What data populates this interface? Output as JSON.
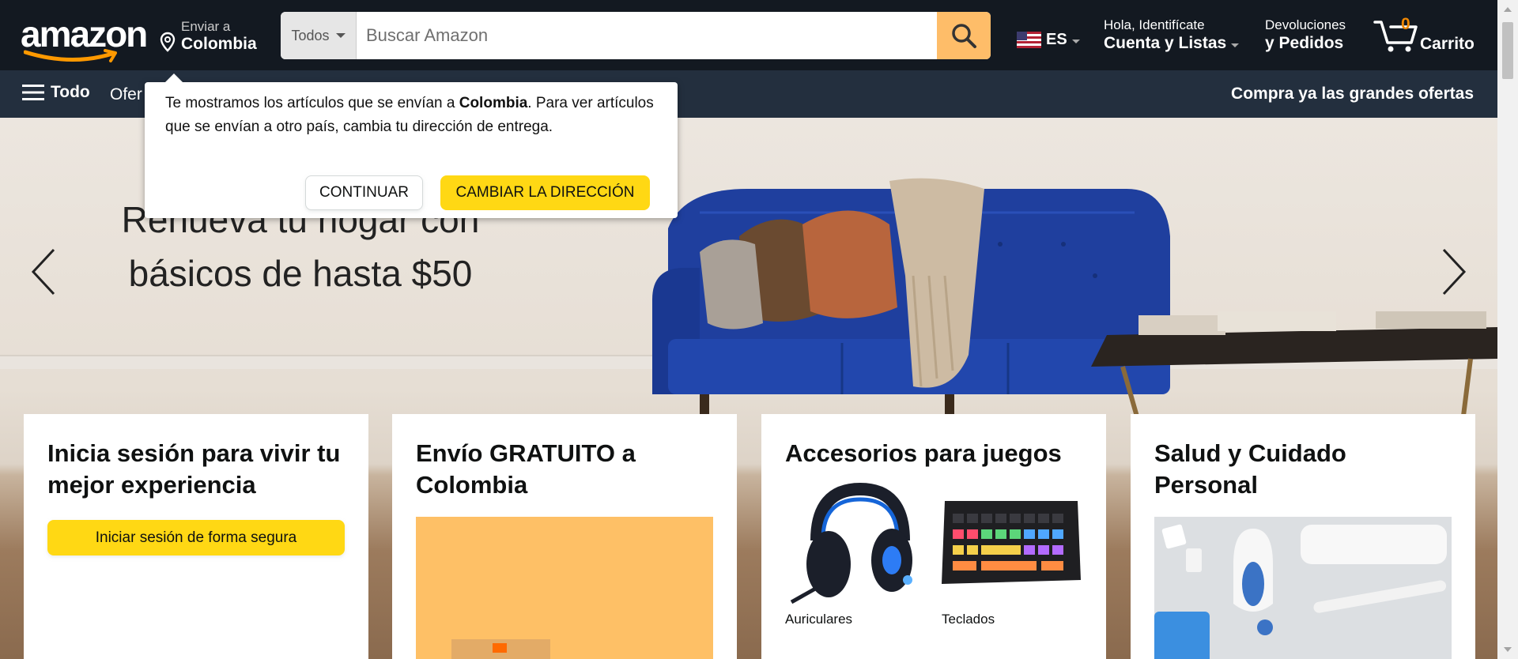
{
  "header": {
    "logo_text": "amazon",
    "deliver": {
      "line1": "Enviar a",
      "line2": "Colombia"
    },
    "search": {
      "category": "Todos",
      "placeholder": "Buscar Amazon"
    },
    "language": {
      "code": "ES"
    },
    "account": {
      "line1": "Hola, Identifícate",
      "line2": "Cuenta y Listas"
    },
    "returns": {
      "line1": "Devoluciones",
      "line2": "y Pedidos"
    },
    "cart": {
      "count": "0",
      "label": "Carrito"
    }
  },
  "subnav": {
    "all_label": "Todo",
    "ofertas_label": "Ofer",
    "promo": "Compra ya las grandes ofertas"
  },
  "popover": {
    "text_before": "Te mostramos los artículos que se envían a ",
    "country": "Colombia",
    "text_after": ". Para ver artículos que se envían a otro país, cambia tu dirección de entrega.",
    "continue_label": "CONTINUAR",
    "change_label": "CAMBIAR LA DIRECCIÓN"
  },
  "hero": {
    "headline_line1": "Renueva tu hogar con",
    "headline_line2": "básicos de hasta $50"
  },
  "cards": [
    {
      "title": "Inicia sesión para vivir tu mejor experiencia",
      "button": "Iniciar sesión de forma segura"
    },
    {
      "title": "Envío GRATUITO a Colombia"
    },
    {
      "title": "Accesorios para juegos",
      "items": [
        {
          "caption": "Auriculares"
        },
        {
          "caption": "Teclados"
        }
      ]
    },
    {
      "title": "Salud y Cuidado Personal"
    }
  ],
  "colors": {
    "nav_top": "#131921",
    "nav_sub": "#232f3e",
    "search_button": "#febd69",
    "primary_button": "#ffd814",
    "cart_count": "#f08804"
  },
  "icons": {
    "deliver": "location-pin-icon",
    "search": "magnifier-icon",
    "menu": "hamburger-icon",
    "cart": "cart-icon",
    "prev": "chevron-left-icon",
    "next": "chevron-right-icon"
  }
}
